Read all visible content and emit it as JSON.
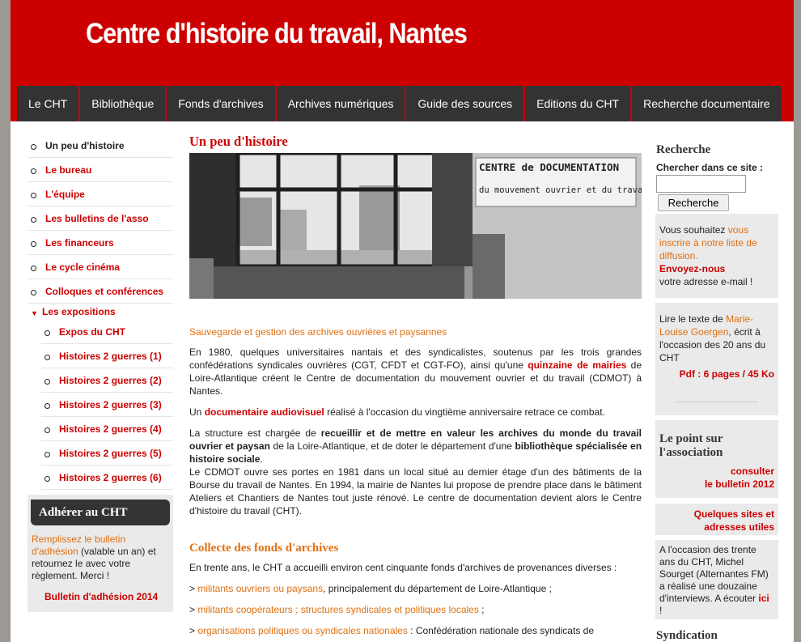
{
  "site": {
    "title": "Centre d'histoire du travail, Nantes"
  },
  "nav": [
    "Le CHT",
    "Bibliothèque",
    "Fonds d'archives",
    "Archives numériques",
    "Guide des sources",
    "Editions du CHT",
    "Recherche documentaire"
  ],
  "left_menu": {
    "items": [
      "Un peu d'histoire",
      "Le bureau",
      "L'équipe",
      "Les bulletins de l'asso",
      "Les financeurs",
      "Le cycle cinéma",
      "Colloques et conférences"
    ],
    "expositions_label": "Les expositions",
    "expositions": [
      "Expos du CHT",
      "Histoires 2 guerres (1)",
      "Histoires 2 guerres (2)",
      "Histoires 2 guerres (3)",
      "Histoires 2 guerres (4)",
      "Histoires 2 guerres (5)",
      "Histoires 2 guerres (6)"
    ]
  },
  "adhesion": {
    "title": "Adhérer au CHT",
    "link": "Remplissez le bulletin d'adhésion",
    "text": " (valable un an) et retournez le avec  votre règlement. Merci !",
    "bulletin": "Bulletin d'adhésion 2014"
  },
  "main": {
    "title": "Un peu d'histoire",
    "photo_sign_line1": "CENTRE de DOCUMENTATION",
    "photo_sign_line2": "du mouvement ouvrier et du travail",
    "subtitle": "Sauvegarde et gestion des archives ouvrières et paysannes",
    "p1a": "En 1980, quelques universitaires nantais et des syndicalistes, soutenus par les trois grandes confédérations syndicales ouvrières (CGT, CFDT et CGT-FO), ainsi qu'une ",
    "p1_link": "quinzaine de mairies",
    "p1b": " de Loire-Atlantique créent le Centre de documentation du mouvement ouvrier et du travail (CDMOT) à Nantes.",
    "p2a": "Un ",
    "p2_link": "documentaire audiovisuel",
    "p2b": " réalisé à l'occasion du vingtième anniversaire retrace ce combat.",
    "p3a": "La structure est chargée de ",
    "p3_bold1": "recueillir et de mettre en valeur les archives du monde du travail ouvrier et paysan",
    "p3b": " de la Loire-Atlantique, et de doter le département d'une ",
    "p3_bold2": "bibliothèque spécialisée en histoire sociale",
    "p3c": ".",
    "p4": "Le CDMOT ouvre ses portes en 1981 dans un local situé au dernier étage d'un des bâtiments de la Bourse du travail de Nantes. En 1994, la mairie de Nantes lui propose de prendre place dans le bâtiment Ateliers et Chantiers de Nantes tout juste rénové. Le centre de documentation devient alors le Centre d'histoire du travail (CHT).",
    "section2_title": "Collecte des fonds d'archives",
    "p5": "En trente ans, le CHT a accueilli environ cent cinquante fonds d'archives de provenances diverses :",
    "list1_prefix": "> ",
    "list1_link": "militants ouvriers ou paysans",
    "list1_text": ", principalement du département de Loire-Atlantique ;",
    "list2_prefix": "> ",
    "list2_link": "militants coopérateurs ; structures syndicales et politiques locales",
    "list2_text": " ;",
    "list3_prefix": "> ",
    "list3_link": "organisations politiques ou syndicales nationales",
    "list3_text": " : Confédération nationale des syndicats de"
  },
  "right": {
    "search_title": "Recherche",
    "search_label": "Chercher dans ce site :",
    "search_value": "",
    "search_button": "Recherche",
    "box1_text1": "Vous souhaitez ",
    "box1_link": "vous inscrire à notre liste de diffusion.",
    "box1_bold": "Envoyez-nous",
    "box1_text2": "votre adresse e-mail !",
    "box2_text1": "Lire le texte de ",
    "box2_link": "Marie-Louise Goergen",
    "box2_text2": ", écrit à l'occasion des 20 ans du CHT",
    "box2_pdf": "Pdf : 6 pages / 45 Ko",
    "box3_title": "Le point sur l'association",
    "box3_link1": "consulter",
    "box3_link2": "le bulletin 2012",
    "box4_link1": "Quelques sites et",
    "box4_link2": "adresses utiles",
    "box5_text": "A l'occasion des trente ans du CHT, Michel Sourget (Alternantes FM) a réalisé une douzaine d'interviews. A écouter ",
    "box5_link": "ici",
    "box5_end": " !",
    "syndication_title": "Syndication"
  },
  "colors": {
    "brand_red": "#cc0000",
    "nav_dark": "#333333",
    "link_orange": "#e07010",
    "sidebar_gray": "#eaeaea"
  }
}
